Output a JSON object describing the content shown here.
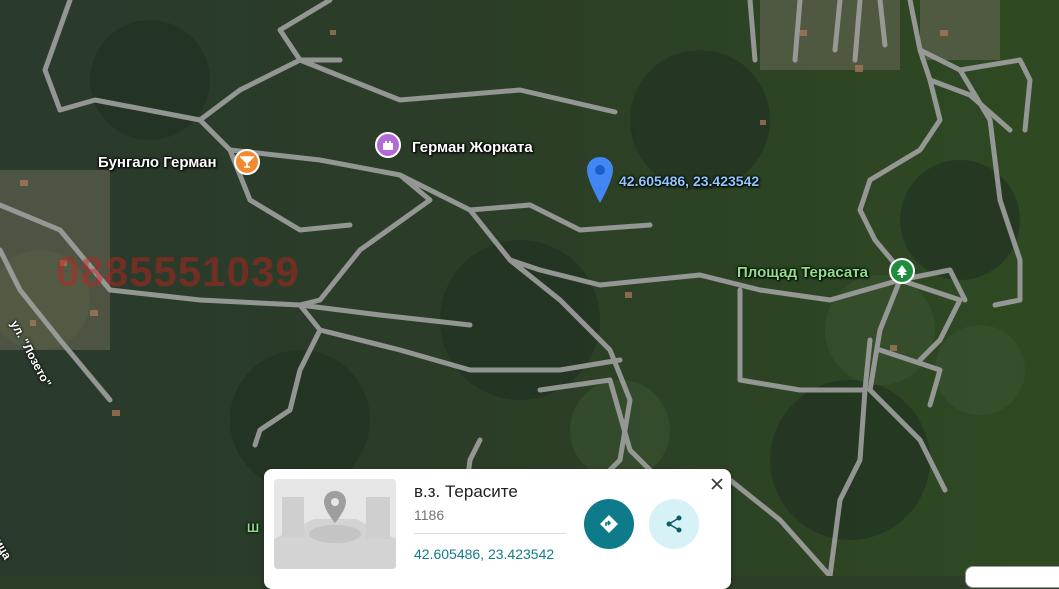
{
  "map": {
    "pois": [
      {
        "name": "Бунгало Герман",
        "icon": "cocktail-icon",
        "color": "#f28b30"
      },
      {
        "name": "Герман Жорката",
        "icon": "castle-icon",
        "color": "#b36ad6"
      },
      {
        "name": "Площад Терасата",
        "icon": "tree-icon",
        "color": "#1e8e3e"
      }
    ],
    "pin": {
      "coords": "42.605486, 23.423542",
      "color": "#4285f4"
    },
    "watermark": "0885551039",
    "streets": [
      "ул. \"Лозето\"",
      "Ш",
      "ница"
    ]
  },
  "card": {
    "title": "в.з. Терасите",
    "subtitle": "1186",
    "coords": "42.605486, 23.423542",
    "accent": "#0e7b8a"
  }
}
